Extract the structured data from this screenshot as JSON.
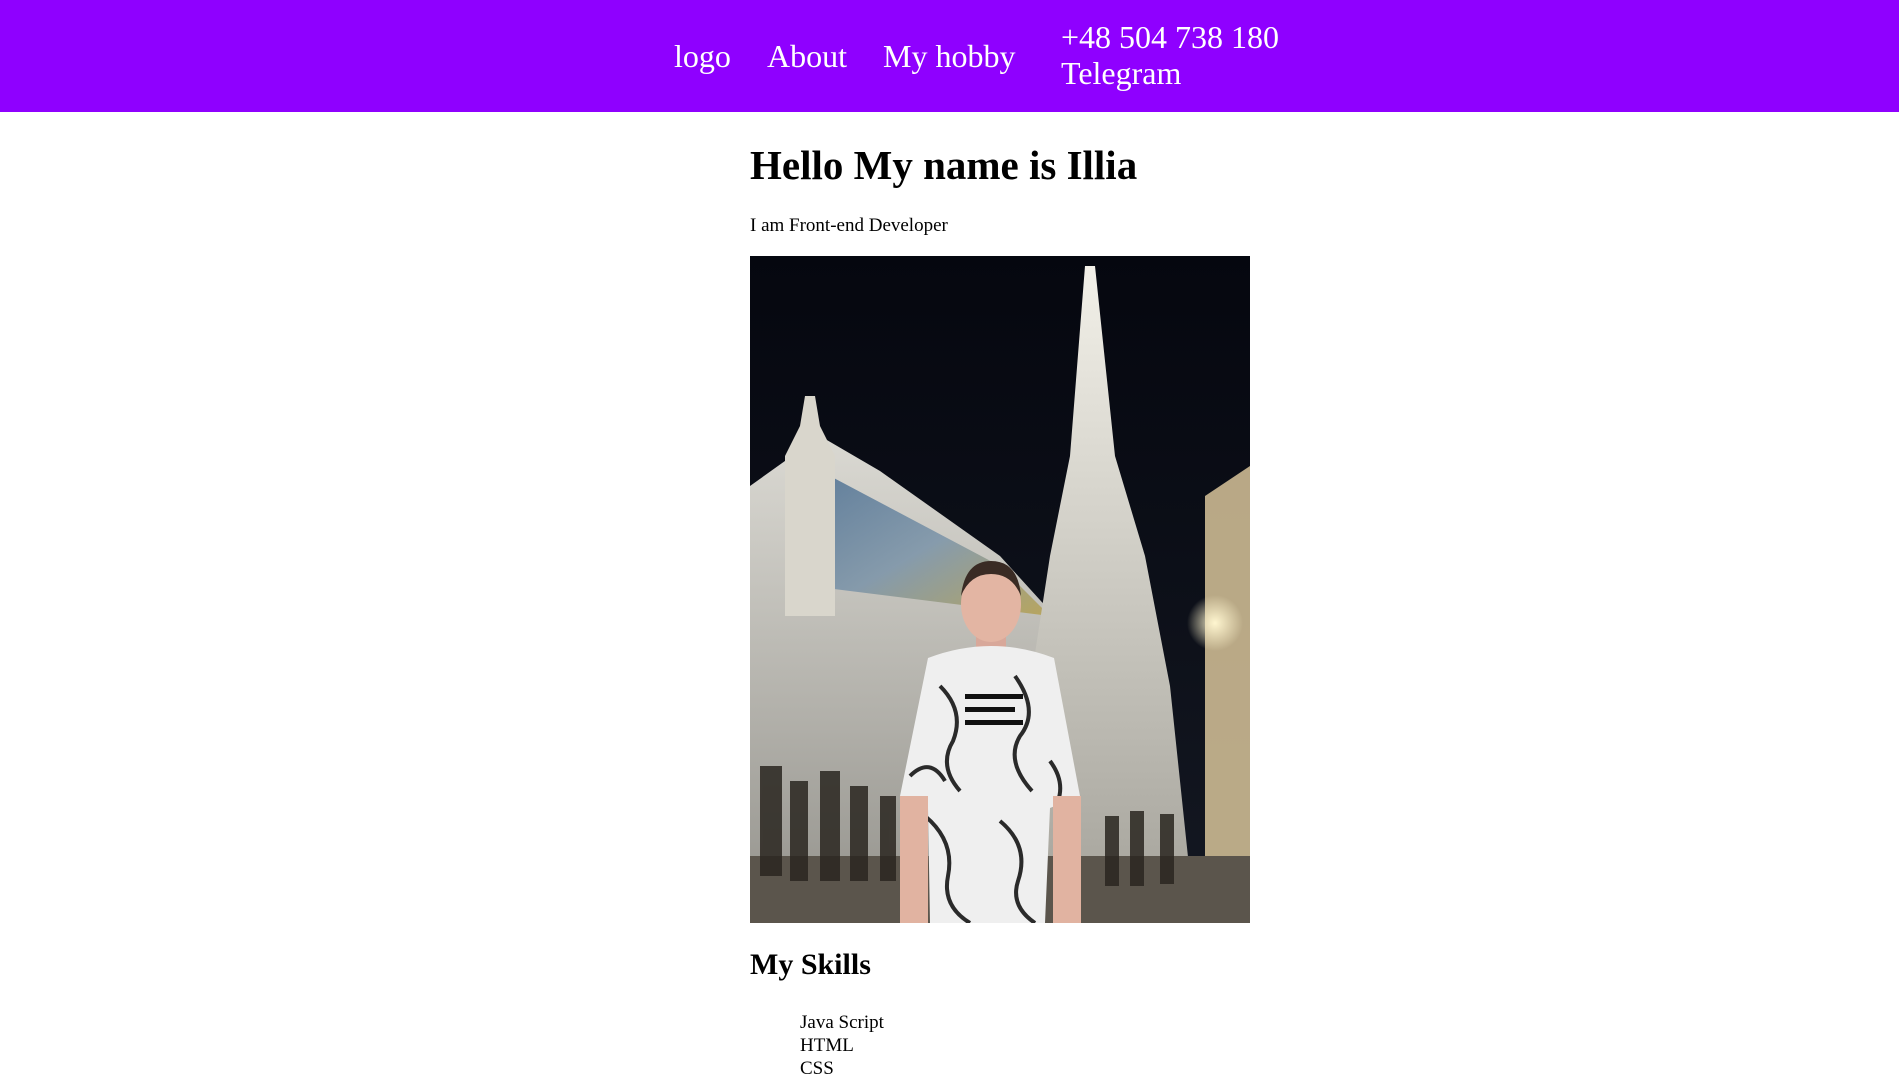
{
  "navbar": {
    "background": "#8f00ff",
    "logo": "logo",
    "about": "About",
    "hobby": "My hobby",
    "phone": "+48 504 738 180",
    "telegram": "Telegram"
  },
  "main": {
    "title": "Hello My name is Illia",
    "subtitle": "I am Front-end Developer",
    "photo_icon": "portrait-photo",
    "skills_title": "My Skills",
    "skills": [
      "Java Script",
      "HTML",
      "CSS"
    ]
  }
}
